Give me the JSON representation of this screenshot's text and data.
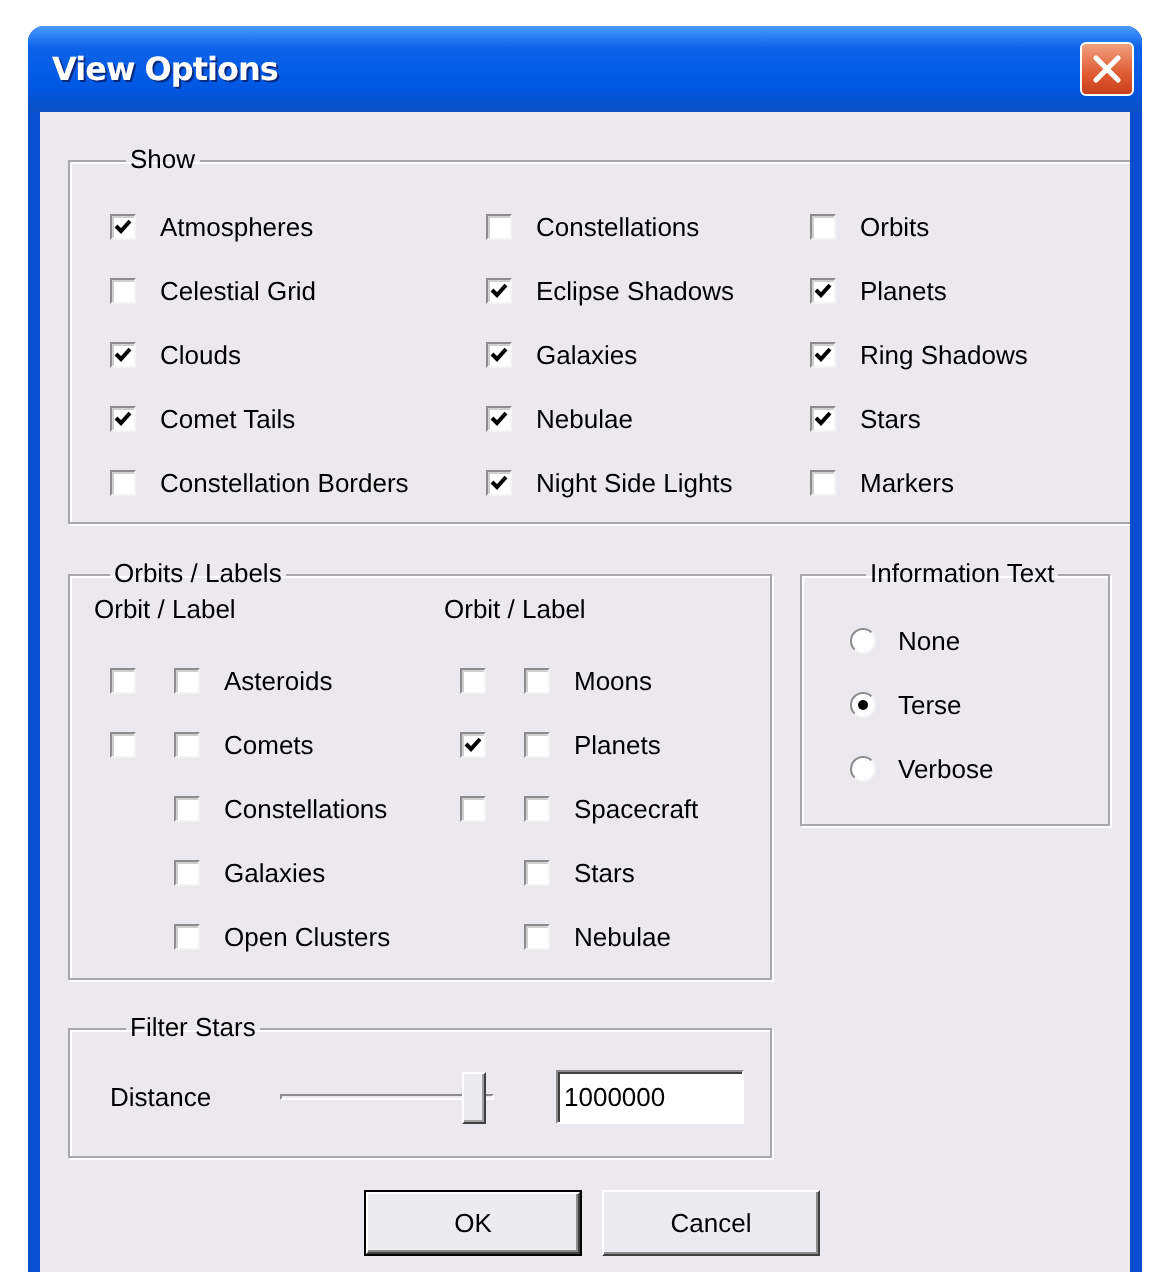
{
  "window": {
    "title": "View Options"
  },
  "show": {
    "label": "Show",
    "columns": [
      [
        {
          "label": "Atmospheres",
          "checked": true
        },
        {
          "label": "Celestial Grid",
          "checked": false
        },
        {
          "label": "Clouds",
          "checked": true
        },
        {
          "label": "Comet Tails",
          "checked": true
        },
        {
          "label": "Constellation Borders",
          "checked": false
        }
      ],
      [
        {
          "label": "Constellations",
          "checked": false
        },
        {
          "label": "Eclipse Shadows",
          "checked": true
        },
        {
          "label": "Galaxies",
          "checked": true
        },
        {
          "label": "Nebulae",
          "checked": true
        },
        {
          "label": "Night Side Lights",
          "checked": true
        }
      ],
      [
        {
          "label": "Orbits",
          "checked": false
        },
        {
          "label": "Planets",
          "checked": true
        },
        {
          "label": "Ring Shadows",
          "checked": true
        },
        {
          "label": "Stars",
          "checked": true
        },
        {
          "label": "Markers",
          "checked": false
        }
      ]
    ]
  },
  "orbits_labels": {
    "label": "Orbits / Labels",
    "columns": [
      {
        "header": "Orbit / Label",
        "items": [
          {
            "label": "Asteroids",
            "orbit": false,
            "labeled": false
          },
          {
            "label": "Comets",
            "orbit": false,
            "labeled": false
          },
          {
            "label": "Constellations",
            "labeled": false
          },
          {
            "label": "Galaxies",
            "labeled": false
          },
          {
            "label": "Open Clusters",
            "labeled": false
          }
        ]
      },
      {
        "header": "Orbit / Label",
        "items": [
          {
            "label": "Moons",
            "orbit": false,
            "labeled": false
          },
          {
            "label": "Planets",
            "orbit": true,
            "labeled": false
          },
          {
            "label": "Spacecraft",
            "orbit": false,
            "labeled": false
          },
          {
            "label": "Stars",
            "labeled": false
          },
          {
            "label": "Nebulae",
            "labeled": false
          }
        ]
      }
    ]
  },
  "information_text": {
    "label": "Information Text",
    "options": [
      {
        "label": "None",
        "selected": false
      },
      {
        "label": "Terse",
        "selected": true
      },
      {
        "label": "Verbose",
        "selected": false
      }
    ]
  },
  "filter_stars": {
    "label": "Filter Stars",
    "distance": {
      "label": "Distance",
      "level": 0.95,
      "value": "1000000"
    }
  },
  "buttons": [
    {
      "label": "OK",
      "default": true
    },
    {
      "label": "Cancel",
      "default": false
    }
  ]
}
